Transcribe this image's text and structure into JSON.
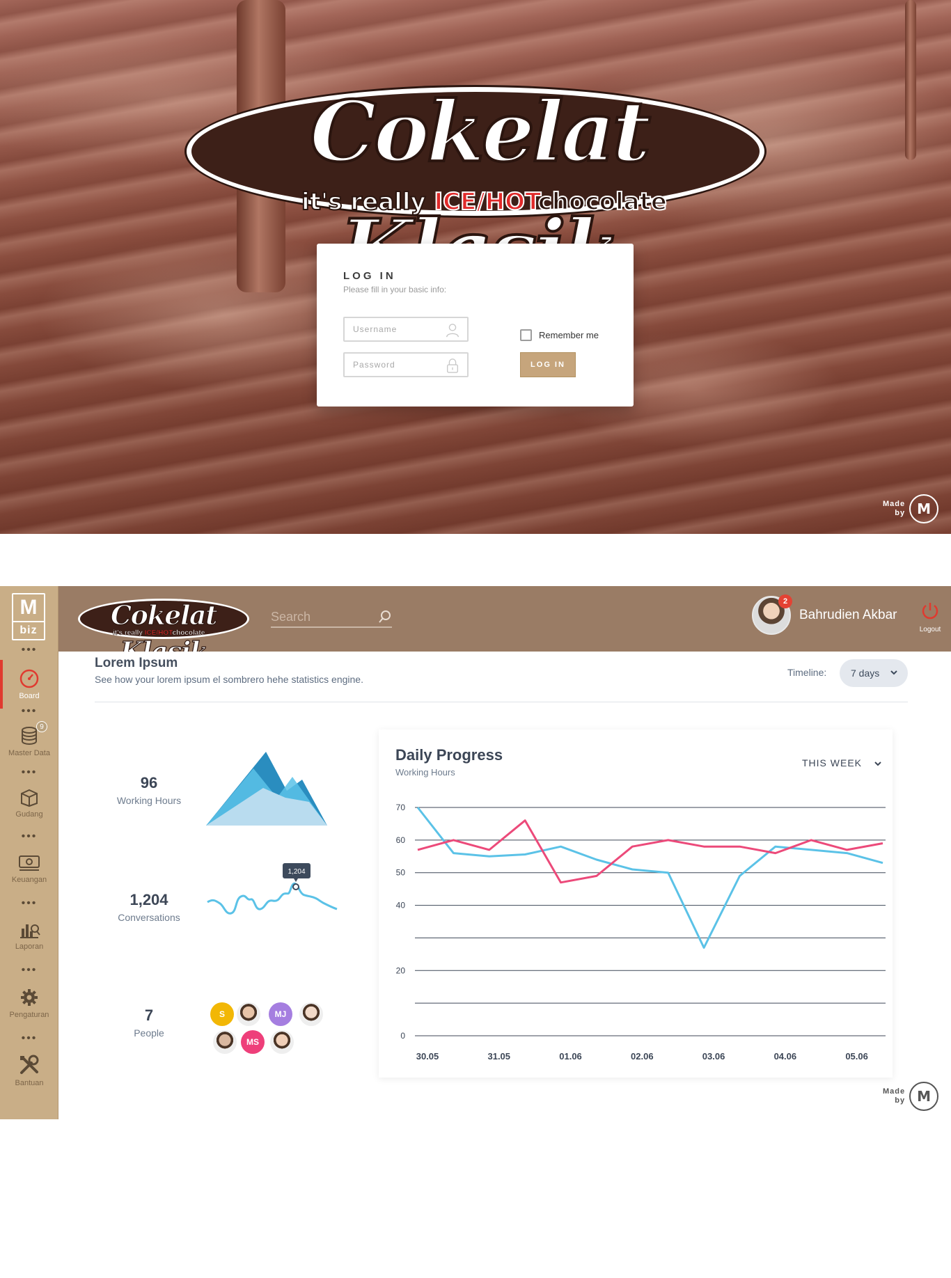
{
  "brand": {
    "logo_main": "Cokelat Klasik",
    "logo_tag_pre": "it's really",
    "logo_tag_red": "ICE/HOT",
    "logo_tag_post": "chocolate",
    "box_top": "M",
    "box_bottom": "biz"
  },
  "login": {
    "title": "LOG IN",
    "subtitle": "Please fill in your basic info:",
    "username_placeholder": "Username",
    "password_placeholder": "Password",
    "remember_label": "Remember me",
    "button_label": "LOG IN"
  },
  "made_by": {
    "line1": "Made",
    "line2": "by",
    "mark": "M"
  },
  "sidebar": {
    "items": [
      {
        "label": "Board",
        "icon": "gauge-icon"
      },
      {
        "label": "Master Data",
        "icon": "database-icon",
        "badge": "9"
      },
      {
        "label": "Gudang",
        "icon": "box-icon"
      },
      {
        "label": "Keuangan",
        "icon": "money-icon"
      },
      {
        "label": "Laporan",
        "icon": "report-icon"
      },
      {
        "label": "Pengaturan",
        "icon": "gear-icon"
      },
      {
        "label": "Bantuan",
        "icon": "tools-icon"
      }
    ],
    "separator": "•••"
  },
  "topbar": {
    "search_placeholder": "Search",
    "user_name": "Bahrudien Akbar",
    "notification_count": "2",
    "logout_label": "Logout"
  },
  "section": {
    "title": "Lorem Ipsum",
    "subtitle": "See how your lorem ipsum el sombrero hehe statistics engine.",
    "timeline_label": "Timeline:",
    "timeline_value": "7 days"
  },
  "stats": {
    "working_hours": {
      "value": "96",
      "label": "Working Hours"
    },
    "conversations": {
      "value": "1,204",
      "label": "Conversations",
      "tooltip": "1,204"
    },
    "people": {
      "value": "7",
      "label": "People"
    }
  },
  "people": [
    {
      "initials": "S",
      "color": "#f2b705",
      "photo": false
    },
    {
      "initials": "",
      "color": "#e8c4a8",
      "photo": true
    },
    {
      "initials": "MJ",
      "color": "#a57ee0",
      "photo": false
    },
    {
      "initials": "",
      "color": "#f1d9c8",
      "photo": true
    },
    {
      "initials": "",
      "color": "#d9b8a0",
      "photo": true
    },
    {
      "initials": "MS",
      "color": "#ee3f7a",
      "photo": false
    },
    {
      "initials": "",
      "color": "#f0cfb8",
      "photo": true
    }
  ],
  "colors": {
    "accent_red": "#e03a2f",
    "sidebar": "#c9ae87",
    "topbar": "#9a7c65",
    "series_blue": "#5bc2e7",
    "series_pink": "#ec4a7a"
  },
  "chart_data": {
    "type": "line",
    "title": "Daily Progress",
    "subtitle": "Working Hours",
    "range_label": "THIS WEEK",
    "x": [
      "30.05",
      "",
      "31.05",
      "",
      "01.06",
      "",
      "02.06",
      "",
      "03.06",
      "",
      "04.06",
      "",
      "05.06",
      ""
    ],
    "xticks": [
      "30.05",
      "31.05",
      "01.06",
      "02.06",
      "03.06",
      "04.06",
      "05.06"
    ],
    "yticks": [
      0,
      20,
      40,
      50,
      60,
      70
    ],
    "ylim": [
      0,
      70
    ],
    "grid": true,
    "series": [
      {
        "color": "#5bc2e7",
        "values": [
          70,
          56,
          55,
          55.6,
          58,
          54,
          51,
          50,
          27,
          49,
          58,
          57,
          56,
          53
        ]
      },
      {
        "color": "#ec4a7a",
        "values": [
          57,
          60,
          57,
          66,
          47,
          49,
          58,
          60,
          58,
          58,
          56,
          60,
          57,
          59
        ]
      }
    ]
  }
}
